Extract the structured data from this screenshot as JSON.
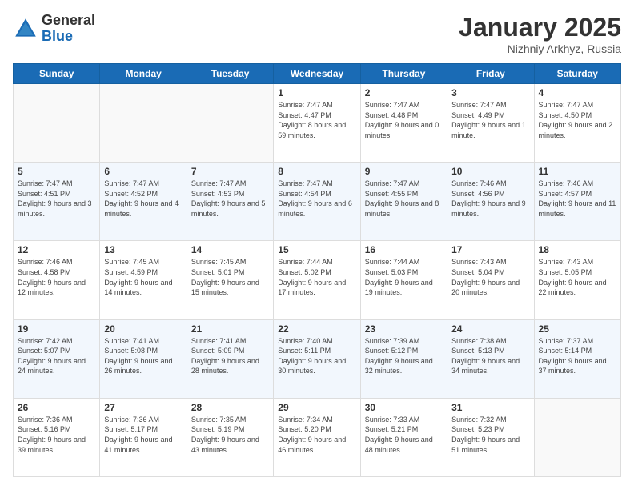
{
  "header": {
    "logo_general": "General",
    "logo_blue": "Blue",
    "title": "January 2025",
    "subtitle": "Nizhniy Arkhyz, Russia"
  },
  "days_of_week": [
    "Sunday",
    "Monday",
    "Tuesday",
    "Wednesday",
    "Thursday",
    "Friday",
    "Saturday"
  ],
  "weeks": [
    {
      "alt": false,
      "days": [
        {
          "num": "",
          "info": ""
        },
        {
          "num": "",
          "info": ""
        },
        {
          "num": "",
          "info": ""
        },
        {
          "num": "1",
          "info": "Sunrise: 7:47 AM\nSunset: 4:47 PM\nDaylight: 8 hours and 59 minutes."
        },
        {
          "num": "2",
          "info": "Sunrise: 7:47 AM\nSunset: 4:48 PM\nDaylight: 9 hours and 0 minutes."
        },
        {
          "num": "3",
          "info": "Sunrise: 7:47 AM\nSunset: 4:49 PM\nDaylight: 9 hours and 1 minute."
        },
        {
          "num": "4",
          "info": "Sunrise: 7:47 AM\nSunset: 4:50 PM\nDaylight: 9 hours and 2 minutes."
        }
      ]
    },
    {
      "alt": true,
      "days": [
        {
          "num": "5",
          "info": "Sunrise: 7:47 AM\nSunset: 4:51 PM\nDaylight: 9 hours and 3 minutes."
        },
        {
          "num": "6",
          "info": "Sunrise: 7:47 AM\nSunset: 4:52 PM\nDaylight: 9 hours and 4 minutes."
        },
        {
          "num": "7",
          "info": "Sunrise: 7:47 AM\nSunset: 4:53 PM\nDaylight: 9 hours and 5 minutes."
        },
        {
          "num": "8",
          "info": "Sunrise: 7:47 AM\nSunset: 4:54 PM\nDaylight: 9 hours and 6 minutes."
        },
        {
          "num": "9",
          "info": "Sunrise: 7:47 AM\nSunset: 4:55 PM\nDaylight: 9 hours and 8 minutes."
        },
        {
          "num": "10",
          "info": "Sunrise: 7:46 AM\nSunset: 4:56 PM\nDaylight: 9 hours and 9 minutes."
        },
        {
          "num": "11",
          "info": "Sunrise: 7:46 AM\nSunset: 4:57 PM\nDaylight: 9 hours and 11 minutes."
        }
      ]
    },
    {
      "alt": false,
      "days": [
        {
          "num": "12",
          "info": "Sunrise: 7:46 AM\nSunset: 4:58 PM\nDaylight: 9 hours and 12 minutes."
        },
        {
          "num": "13",
          "info": "Sunrise: 7:45 AM\nSunset: 4:59 PM\nDaylight: 9 hours and 14 minutes."
        },
        {
          "num": "14",
          "info": "Sunrise: 7:45 AM\nSunset: 5:01 PM\nDaylight: 9 hours and 15 minutes."
        },
        {
          "num": "15",
          "info": "Sunrise: 7:44 AM\nSunset: 5:02 PM\nDaylight: 9 hours and 17 minutes."
        },
        {
          "num": "16",
          "info": "Sunrise: 7:44 AM\nSunset: 5:03 PM\nDaylight: 9 hours and 19 minutes."
        },
        {
          "num": "17",
          "info": "Sunrise: 7:43 AM\nSunset: 5:04 PM\nDaylight: 9 hours and 20 minutes."
        },
        {
          "num": "18",
          "info": "Sunrise: 7:43 AM\nSunset: 5:05 PM\nDaylight: 9 hours and 22 minutes."
        }
      ]
    },
    {
      "alt": true,
      "days": [
        {
          "num": "19",
          "info": "Sunrise: 7:42 AM\nSunset: 5:07 PM\nDaylight: 9 hours and 24 minutes."
        },
        {
          "num": "20",
          "info": "Sunrise: 7:41 AM\nSunset: 5:08 PM\nDaylight: 9 hours and 26 minutes."
        },
        {
          "num": "21",
          "info": "Sunrise: 7:41 AM\nSunset: 5:09 PM\nDaylight: 9 hours and 28 minutes."
        },
        {
          "num": "22",
          "info": "Sunrise: 7:40 AM\nSunset: 5:11 PM\nDaylight: 9 hours and 30 minutes."
        },
        {
          "num": "23",
          "info": "Sunrise: 7:39 AM\nSunset: 5:12 PM\nDaylight: 9 hours and 32 minutes."
        },
        {
          "num": "24",
          "info": "Sunrise: 7:38 AM\nSunset: 5:13 PM\nDaylight: 9 hours and 34 minutes."
        },
        {
          "num": "25",
          "info": "Sunrise: 7:37 AM\nSunset: 5:14 PM\nDaylight: 9 hours and 37 minutes."
        }
      ]
    },
    {
      "alt": false,
      "days": [
        {
          "num": "26",
          "info": "Sunrise: 7:36 AM\nSunset: 5:16 PM\nDaylight: 9 hours and 39 minutes."
        },
        {
          "num": "27",
          "info": "Sunrise: 7:36 AM\nSunset: 5:17 PM\nDaylight: 9 hours and 41 minutes."
        },
        {
          "num": "28",
          "info": "Sunrise: 7:35 AM\nSunset: 5:19 PM\nDaylight: 9 hours and 43 minutes."
        },
        {
          "num": "29",
          "info": "Sunrise: 7:34 AM\nSunset: 5:20 PM\nDaylight: 9 hours and 46 minutes."
        },
        {
          "num": "30",
          "info": "Sunrise: 7:33 AM\nSunset: 5:21 PM\nDaylight: 9 hours and 48 minutes."
        },
        {
          "num": "31",
          "info": "Sunrise: 7:32 AM\nSunset: 5:23 PM\nDaylight: 9 hours and 51 minutes."
        },
        {
          "num": "",
          "info": ""
        }
      ]
    }
  ]
}
